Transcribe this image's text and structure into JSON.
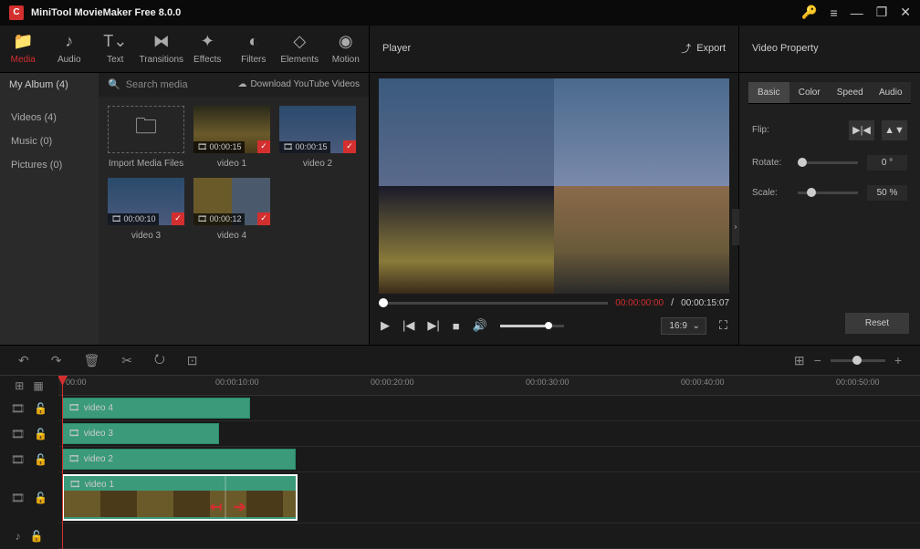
{
  "app": {
    "title": "MiniTool MovieMaker Free 8.0.0"
  },
  "tabs": {
    "media": "Media",
    "audio": "Audio",
    "text": "Text",
    "transitions": "Transitions",
    "effects": "Effects",
    "filters": "Filters",
    "elements": "Elements",
    "motion": "Motion"
  },
  "player": {
    "title": "Player",
    "export": "Export",
    "current": "00:00:00:00",
    "sep": " / ",
    "total": "00:00:15:07",
    "aspect": "16:9"
  },
  "media": {
    "album": "My Album (4)",
    "search": "Search media",
    "download": "Download YouTube Videos",
    "sidebar": {
      "videos": "Videos (4)",
      "music": "Music (0)",
      "pictures": "Pictures (0)"
    },
    "import": "Import Media Files",
    "items": [
      {
        "name": "video 1",
        "time": "00:00:15"
      },
      {
        "name": "video 2",
        "time": "00:00:15"
      },
      {
        "name": "video 3",
        "time": "00:00:10"
      },
      {
        "name": "video 4",
        "time": "00:00:12"
      }
    ]
  },
  "props": {
    "title": "Video Property",
    "tabs": {
      "basic": "Basic",
      "color": "Color",
      "speed": "Speed",
      "audio": "Audio"
    },
    "flip": "Flip:",
    "rotate": "Rotate:",
    "rotate_val": "0 °",
    "scale": "Scale:",
    "scale_val": "50 %",
    "reset": "Reset"
  },
  "timeline": {
    "ruler": [
      "00:00",
      "00:00:10:00",
      "00:00:20:00",
      "00:00:30:00",
      "00:00:40:00",
      "00:00:50:00"
    ],
    "clips": {
      "v4": "video 4",
      "v3": "video 3",
      "v2": "video 2",
      "v1": "video 1"
    }
  }
}
